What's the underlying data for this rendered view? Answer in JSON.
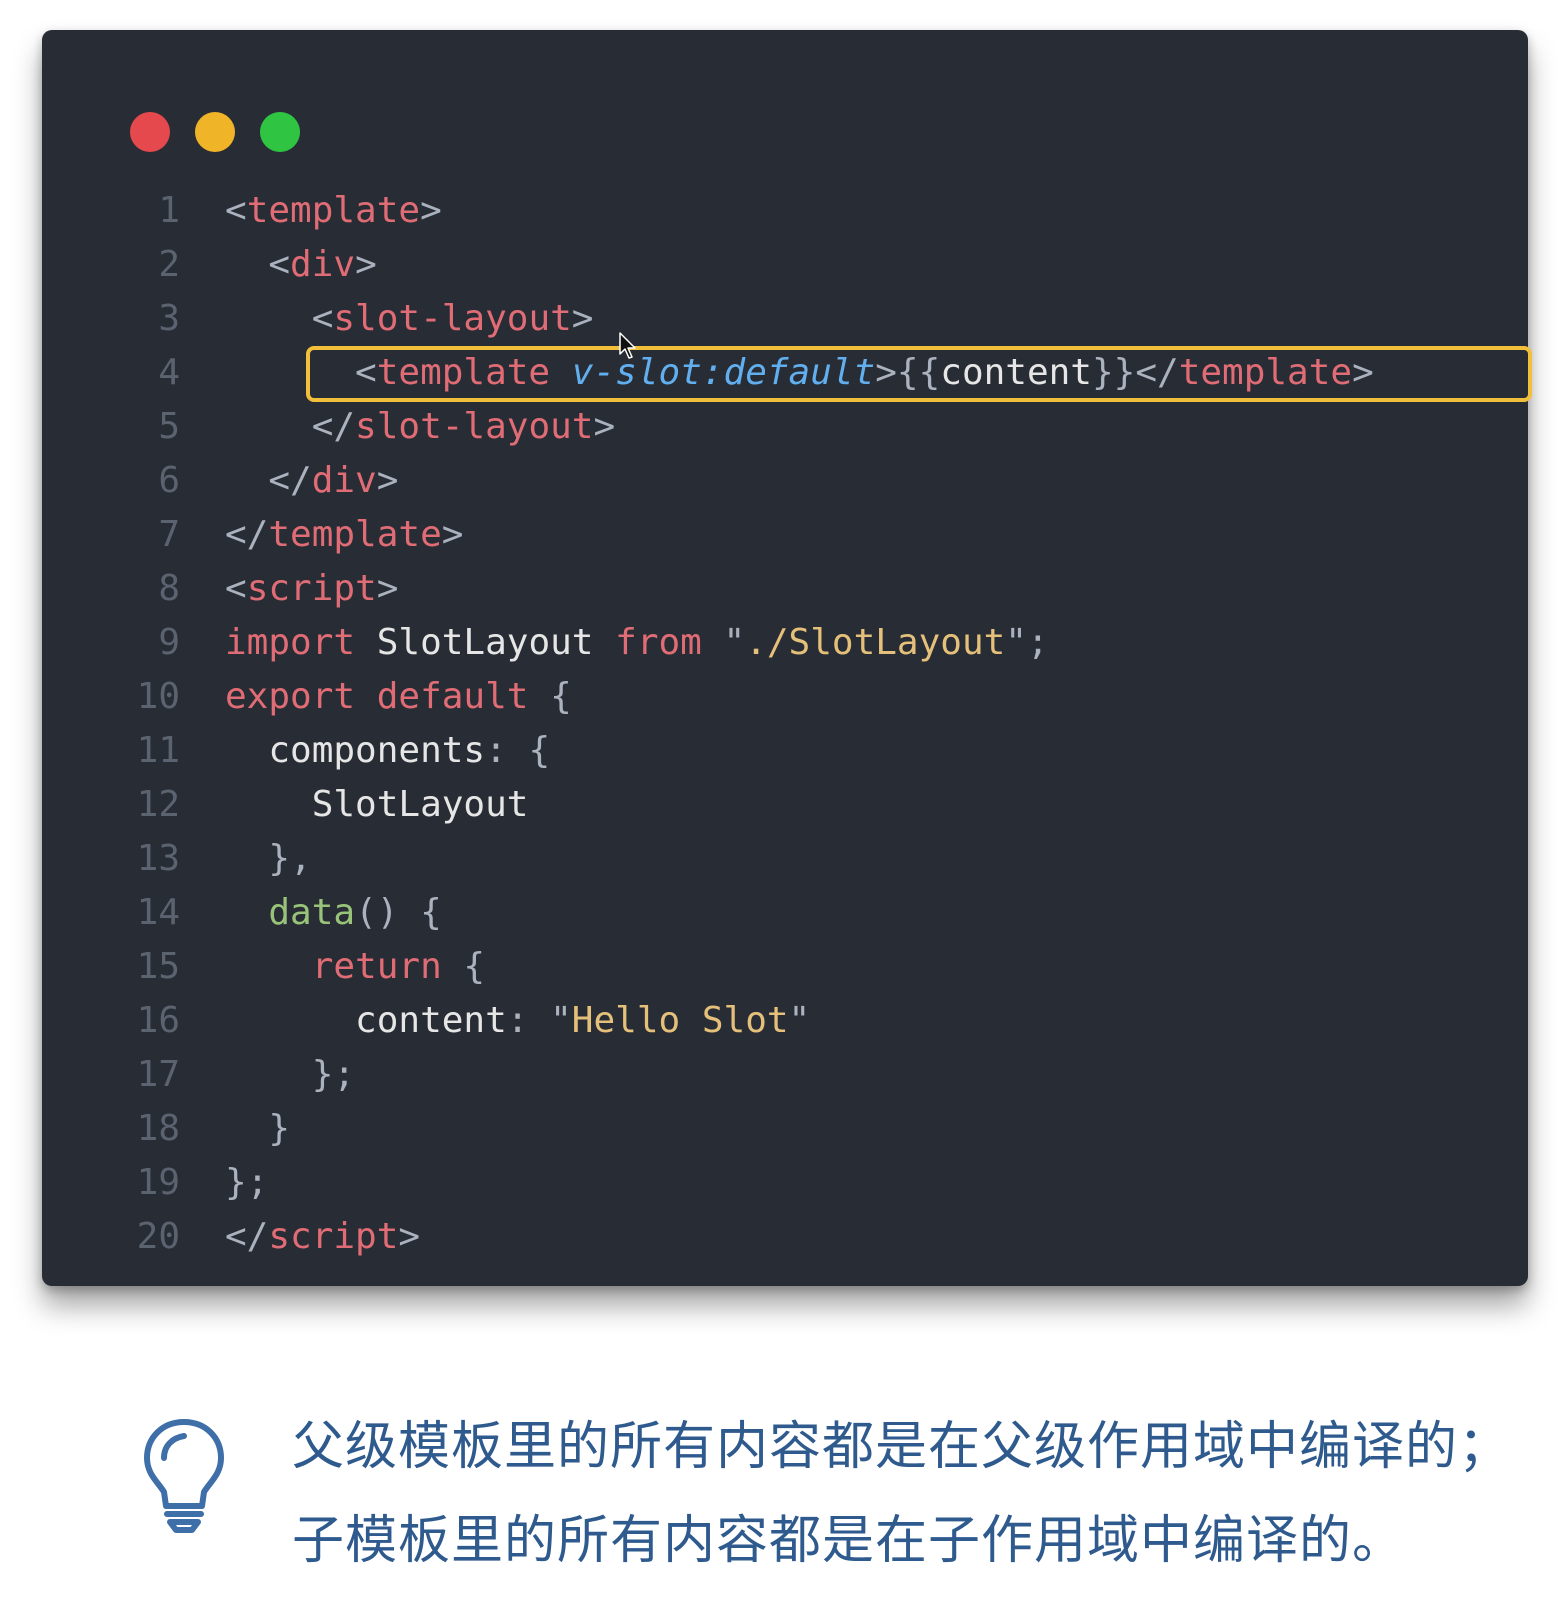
{
  "window": {
    "controls": {
      "close_color": "#e5484d",
      "minimize_color": "#f0b429",
      "maximize_color": "#2fc543"
    },
    "highlight_color": "#f2bf3a"
  },
  "code": {
    "lines": [
      {
        "num": "1",
        "tokens": [
          {
            "t": "<",
            "c": "punc"
          },
          {
            "t": "template",
            "c": "tag"
          },
          {
            "t": ">",
            "c": "punc"
          }
        ]
      },
      {
        "num": "2",
        "tokens": [
          {
            "t": "  <",
            "c": "punc"
          },
          {
            "t": "div",
            "c": "tag"
          },
          {
            "t": ">",
            "c": "punc"
          }
        ]
      },
      {
        "num": "3",
        "tokens": [
          {
            "t": "    <",
            "c": "punc"
          },
          {
            "t": "slot-layout",
            "c": "tag"
          },
          {
            "t": ">",
            "c": "punc"
          }
        ]
      },
      {
        "num": "4",
        "tokens": [
          {
            "t": "      <",
            "c": "punc"
          },
          {
            "t": "template",
            "c": "tag"
          },
          {
            "t": " ",
            "c": "punc"
          },
          {
            "t": "v-slot:default",
            "c": "attr"
          },
          {
            "t": ">{{",
            "c": "punc"
          },
          {
            "t": "content",
            "c": "ident"
          },
          {
            "t": "}}</",
            "c": "punc"
          },
          {
            "t": "template",
            "c": "tag"
          },
          {
            "t": ">",
            "c": "punc"
          }
        ]
      },
      {
        "num": "5",
        "tokens": [
          {
            "t": "    </",
            "c": "punc"
          },
          {
            "t": "slot-layout",
            "c": "tag"
          },
          {
            "t": ">",
            "c": "punc"
          }
        ]
      },
      {
        "num": "6",
        "tokens": [
          {
            "t": "  </",
            "c": "punc"
          },
          {
            "t": "div",
            "c": "tag"
          },
          {
            "t": ">",
            "c": "punc"
          }
        ]
      },
      {
        "num": "7",
        "tokens": [
          {
            "t": "</",
            "c": "punc"
          },
          {
            "t": "template",
            "c": "tag"
          },
          {
            "t": ">",
            "c": "punc"
          }
        ]
      },
      {
        "num": "8",
        "tokens": [
          {
            "t": "<",
            "c": "punc"
          },
          {
            "t": "script",
            "c": "tag"
          },
          {
            "t": ">",
            "c": "punc"
          }
        ]
      },
      {
        "num": "9",
        "tokens": [
          {
            "t": "import",
            "c": "kw"
          },
          {
            "t": " SlotLayout ",
            "c": "ident"
          },
          {
            "t": "from",
            "c": "kw"
          },
          {
            "t": " \"",
            "c": "punc"
          },
          {
            "t": "./SlotLayout",
            "c": "str"
          },
          {
            "t": "\";",
            "c": "punc"
          }
        ]
      },
      {
        "num": "10",
        "tokens": [
          {
            "t": "export",
            "c": "kw"
          },
          {
            "t": " ",
            "c": "punc"
          },
          {
            "t": "default",
            "c": "kw"
          },
          {
            "t": " {",
            "c": "punc"
          }
        ]
      },
      {
        "num": "11",
        "tokens": [
          {
            "t": "  components",
            "c": "ident"
          },
          {
            "t": ": {",
            "c": "punc"
          }
        ]
      },
      {
        "num": "12",
        "tokens": [
          {
            "t": "    SlotLayout",
            "c": "ident"
          }
        ]
      },
      {
        "num": "13",
        "tokens": [
          {
            "t": "  },",
            "c": "punc"
          }
        ]
      },
      {
        "num": "14",
        "tokens": [
          {
            "t": "  ",
            "c": "punc"
          },
          {
            "t": "data",
            "c": "fn"
          },
          {
            "t": "() {",
            "c": "punc"
          }
        ]
      },
      {
        "num": "15",
        "tokens": [
          {
            "t": "    ",
            "c": "punc"
          },
          {
            "t": "return",
            "c": "kw"
          },
          {
            "t": " {",
            "c": "punc"
          }
        ]
      },
      {
        "num": "16",
        "tokens": [
          {
            "t": "      content",
            "c": "ident"
          },
          {
            "t": ": \"",
            "c": "punc"
          },
          {
            "t": "Hello Slot",
            "c": "str"
          },
          {
            "t": "\"",
            "c": "punc"
          }
        ]
      },
      {
        "num": "17",
        "tokens": [
          {
            "t": "    };",
            "c": "punc"
          }
        ]
      },
      {
        "num": "18",
        "tokens": [
          {
            "t": "  }",
            "c": "punc"
          }
        ]
      },
      {
        "num": "19",
        "tokens": [
          {
            "t": "};",
            "c": "punc"
          }
        ]
      },
      {
        "num": "20",
        "tokens": [
          {
            "t": "</",
            "c": "punc"
          },
          {
            "t": "script",
            "c": "tag"
          },
          {
            "t": ">",
            "c": "punc"
          }
        ]
      }
    ]
  },
  "note": {
    "icon": "lightbulb-icon",
    "line1": "父级模板里的所有内容都是在父级作用域中编译的；",
    "line2": "子模板里的所有内容都是在子作用域中编译的。"
  }
}
